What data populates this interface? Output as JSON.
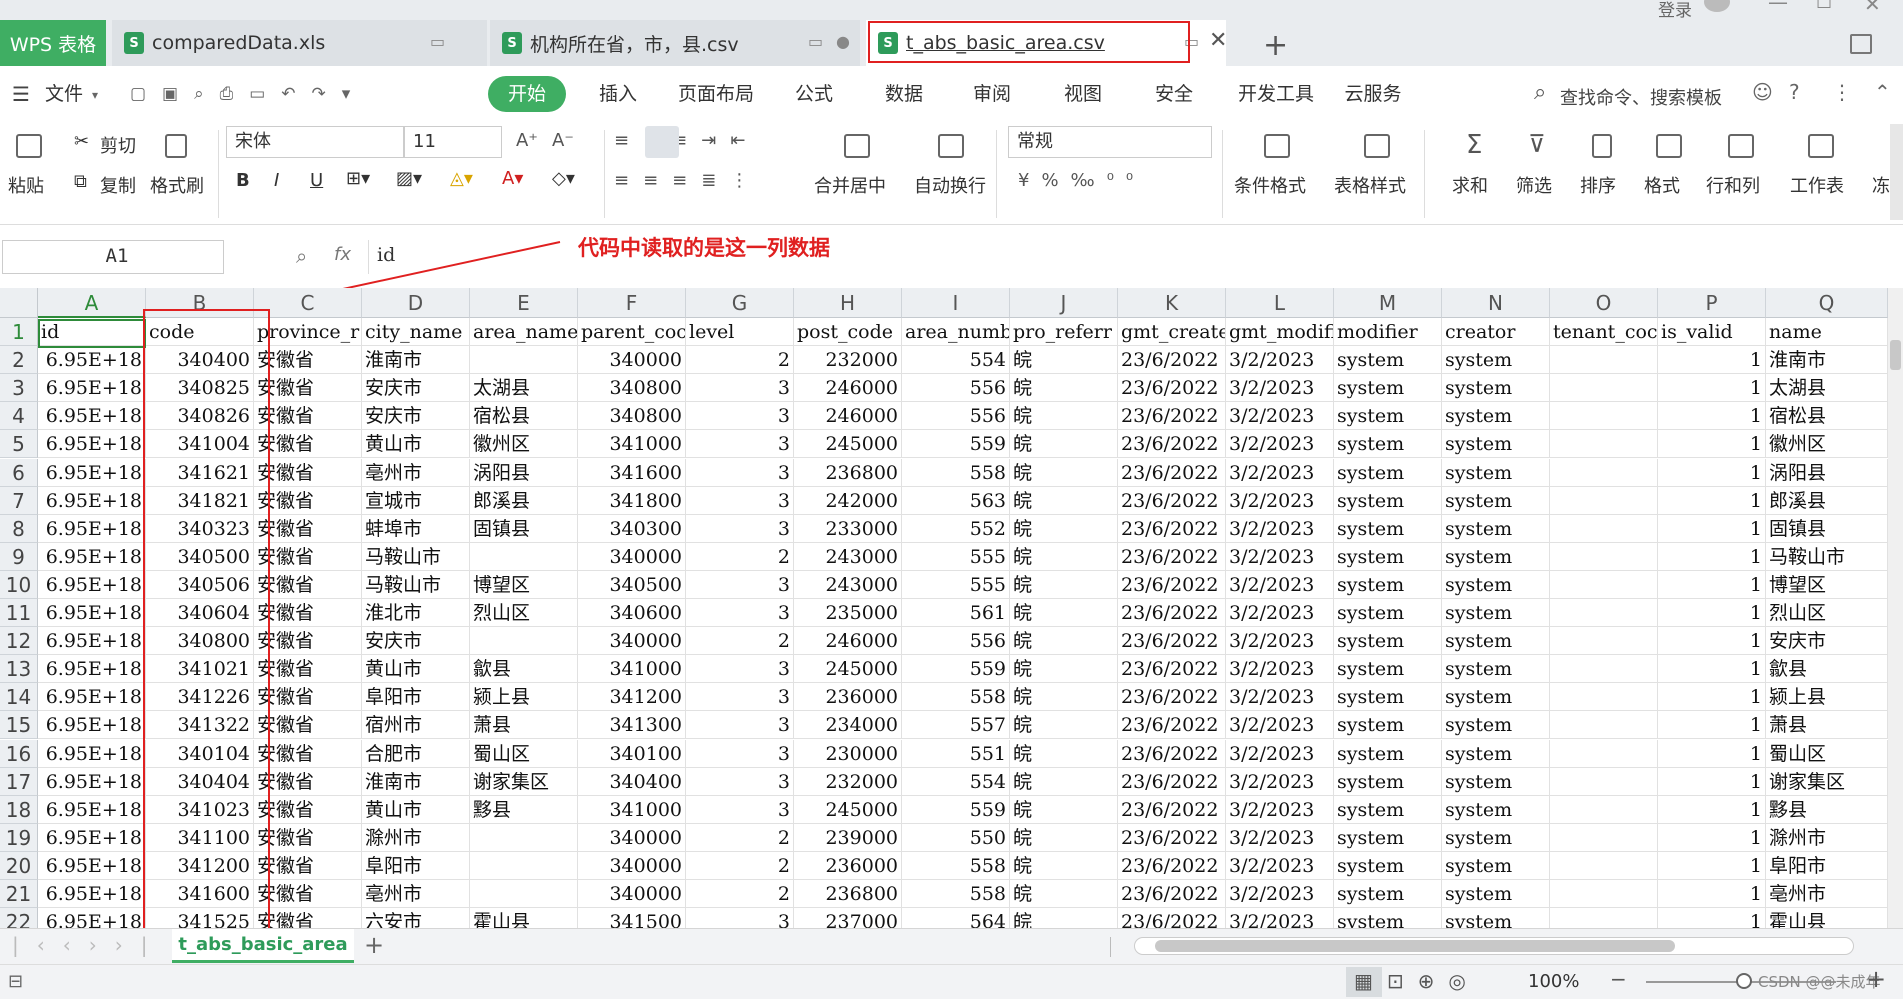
{
  "titlebar": {
    "app_tab": "WPS 表格",
    "tabs": [
      {
        "label": "comparedData.xls"
      },
      {
        "label": "机构所在省，市，县.csv"
      },
      {
        "label": "t_abs_basic_area.csv"
      }
    ],
    "login": "登录"
  },
  "menu": {
    "file": "文件",
    "items": [
      "开始",
      "插入",
      "页面布局",
      "公式",
      "数据",
      "审阅",
      "视图",
      "安全",
      "开发工具",
      "云服务"
    ],
    "search": "查找命令、搜索模板"
  },
  "ribbon": {
    "paste": "粘贴",
    "cut": "剪切",
    "copy": "复制",
    "format_painter": "格式刷",
    "font_name": "宋体",
    "font_size": "11",
    "merge": "合并居中",
    "wrap": "自动换行",
    "number_format": "常规",
    "cond_format": "条件格式",
    "table_style": "表格样式",
    "sum": "求和",
    "filter": "筛选",
    "sort": "排序",
    "format": "格式",
    "rowcol": "行和列",
    "sheet": "工作表",
    "freeze": "冻"
  },
  "formula_bar": {
    "cell_ref": "A1",
    "fx": "fx",
    "value": "id"
  },
  "annotation": "代码中读取的是这一列数据",
  "columns": [
    "A",
    "B",
    "C",
    "D",
    "E",
    "F",
    "G",
    "H",
    "I",
    "J",
    "K",
    "L",
    "M",
    "N",
    "O",
    "P",
    "Q"
  ],
  "header_row": [
    "id",
    "code",
    "province_r",
    "city_name",
    "area_name",
    "parent_coc",
    "level",
    "post_code",
    "area_numbe",
    "pro_referr",
    "gmt_create",
    "gmt_modifi",
    "modifier",
    "creator",
    "tenant_coc",
    "is_valid",
    "name"
  ],
  "rows": [
    [
      "6.95E+18",
      "340400",
      "安徽省",
      "淮南市",
      "",
      "340000",
      "2",
      "232000",
      "554",
      "皖",
      "23/6/2022",
      "3/2/2023",
      "system",
      "system",
      "",
      "1",
      "淮南市"
    ],
    [
      "6.95E+18",
      "340825",
      "安徽省",
      "安庆市",
      "太湖县",
      "340800",
      "3",
      "246000",
      "556",
      "皖",
      "23/6/2022",
      "3/2/2023",
      "system",
      "system",
      "",
      "1",
      "太湖县"
    ],
    [
      "6.95E+18",
      "340826",
      "安徽省",
      "安庆市",
      "宿松县",
      "340800",
      "3",
      "246000",
      "556",
      "皖",
      "23/6/2022",
      "3/2/2023",
      "system",
      "system",
      "",
      "1",
      "宿松县"
    ],
    [
      "6.95E+18",
      "341004",
      "安徽省",
      "黄山市",
      "徽州区",
      "341000",
      "3",
      "245000",
      "559",
      "皖",
      "23/6/2022",
      "3/2/2023",
      "system",
      "system",
      "",
      "1",
      "徽州区"
    ],
    [
      "6.95E+18",
      "341621",
      "安徽省",
      "亳州市",
      "涡阳县",
      "341600",
      "3",
      "236800",
      "558",
      "皖",
      "23/6/2022",
      "3/2/2023",
      "system",
      "system",
      "",
      "1",
      "涡阳县"
    ],
    [
      "6.95E+18",
      "341821",
      "安徽省",
      "宣城市",
      "郎溪县",
      "341800",
      "3",
      "242000",
      "563",
      "皖",
      "23/6/2022",
      "3/2/2023",
      "system",
      "system",
      "",
      "1",
      "郎溪县"
    ],
    [
      "6.95E+18",
      "340323",
      "安徽省",
      "蚌埠市",
      "固镇县",
      "340300",
      "3",
      "233000",
      "552",
      "皖",
      "23/6/2022",
      "3/2/2023",
      "system",
      "system",
      "",
      "1",
      "固镇县"
    ],
    [
      "6.95E+18",
      "340500",
      "安徽省",
      "马鞍山市",
      "",
      "340000",
      "2",
      "243000",
      "555",
      "皖",
      "23/6/2022",
      "3/2/2023",
      "system",
      "system",
      "",
      "1",
      "马鞍山市"
    ],
    [
      "6.95E+18",
      "340506",
      "安徽省",
      "马鞍山市",
      "博望区",
      "340500",
      "3",
      "243000",
      "555",
      "皖",
      "23/6/2022",
      "3/2/2023",
      "system",
      "system",
      "",
      "1",
      "博望区"
    ],
    [
      "6.95E+18",
      "340604",
      "安徽省",
      "淮北市",
      "烈山区",
      "340600",
      "3",
      "235000",
      "561",
      "皖",
      "23/6/2022",
      "3/2/2023",
      "system",
      "system",
      "",
      "1",
      "烈山区"
    ],
    [
      "6.95E+18",
      "340800",
      "安徽省",
      "安庆市",
      "",
      "340000",
      "2",
      "246000",
      "556",
      "皖",
      "23/6/2022",
      "3/2/2023",
      "system",
      "system",
      "",
      "1",
      "安庆市"
    ],
    [
      "6.95E+18",
      "341021",
      "安徽省",
      "黄山市",
      "歙县",
      "341000",
      "3",
      "245000",
      "559",
      "皖",
      "23/6/2022",
      "3/2/2023",
      "system",
      "system",
      "",
      "1",
      "歙县"
    ],
    [
      "6.95E+18",
      "341226",
      "安徽省",
      "阜阳市",
      "颍上县",
      "341200",
      "3",
      "236000",
      "558",
      "皖",
      "23/6/2022",
      "3/2/2023",
      "system",
      "system",
      "",
      "1",
      "颍上县"
    ],
    [
      "6.95E+18",
      "341322",
      "安徽省",
      "宿州市",
      "萧县",
      "341300",
      "3",
      "234000",
      "557",
      "皖",
      "23/6/2022",
      "3/2/2023",
      "system",
      "system",
      "",
      "1",
      "萧县"
    ],
    [
      "6.95E+18",
      "340104",
      "安徽省",
      "合肥市",
      "蜀山区",
      "340100",
      "3",
      "230000",
      "551",
      "皖",
      "23/6/2022",
      "3/2/2023",
      "system",
      "system",
      "",
      "1",
      "蜀山区"
    ],
    [
      "6.95E+18",
      "340404",
      "安徽省",
      "淮南市",
      "谢家集区",
      "340400",
      "3",
      "232000",
      "554",
      "皖",
      "23/6/2022",
      "3/2/2023",
      "system",
      "system",
      "",
      "1",
      "谢家集区"
    ],
    [
      "6.95E+18",
      "341023",
      "安徽省",
      "黄山市",
      "黟县",
      "341000",
      "3",
      "245000",
      "559",
      "皖",
      "23/6/2022",
      "3/2/2023",
      "system",
      "system",
      "",
      "1",
      "黟县"
    ],
    [
      "6.95E+18",
      "341100",
      "安徽省",
      "滁州市",
      "",
      "340000",
      "2",
      "239000",
      "550",
      "皖",
      "23/6/2022",
      "3/2/2023",
      "system",
      "system",
      "",
      "1",
      "滁州市"
    ],
    [
      "6.95E+18",
      "341200",
      "安徽省",
      "阜阳市",
      "",
      "340000",
      "2",
      "236000",
      "558",
      "皖",
      "23/6/2022",
      "3/2/2023",
      "system",
      "system",
      "",
      "1",
      "阜阳市"
    ],
    [
      "6.95E+18",
      "341600",
      "安徽省",
      "亳州市",
      "",
      "340000",
      "2",
      "236800",
      "558",
      "皖",
      "23/6/2022",
      "3/2/2023",
      "system",
      "system",
      "",
      "1",
      "亳州市"
    ],
    [
      "6.95E+18",
      "341525",
      "安徽省",
      "六安市",
      "霍山县",
      "341500",
      "3",
      "237000",
      "564",
      "皖",
      "23/6/2022",
      "3/2/2023",
      "system",
      "system",
      "",
      "1",
      "霍山县"
    ]
  ],
  "sheet_tab": "t_abs_basic_area",
  "status": {
    "zoom": "100%",
    "watermark": "CSDN @@未成年"
  },
  "colors": {
    "accent": "#3fae63",
    "highlight": "#e02020"
  }
}
